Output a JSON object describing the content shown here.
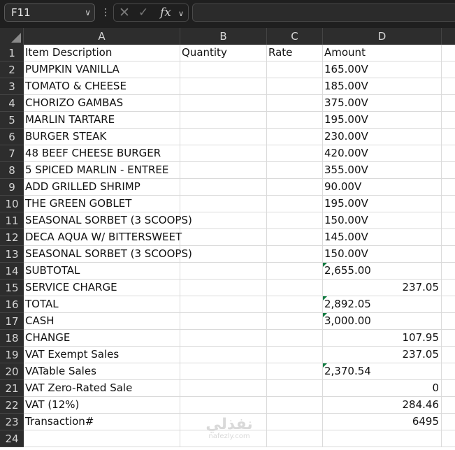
{
  "toolbar": {
    "name_box": "F11",
    "fx_label": "fx",
    "formula_value": ""
  },
  "columns": [
    "A",
    "B",
    "C",
    "D"
  ],
  "rows": [
    {
      "num": "1",
      "a": "Item Description",
      "b": "Quantity",
      "c": "Rate",
      "d_left": "Amount",
      "d_right": ""
    },
    {
      "num": "2",
      "a": "PUMPKIN VANILLA",
      "b": "",
      "c": "",
      "d_left": "165.00V",
      "d_right": ""
    },
    {
      "num": "3",
      "a": "TOMATO & CHEESE",
      "b": "",
      "c": "",
      "d_left": "185.00V",
      "d_right": ""
    },
    {
      "num": "4",
      "a": "CHORIZO GAMBAS",
      "b": "",
      "c": "",
      "d_left": "375.00V",
      "d_right": ""
    },
    {
      "num": "5",
      "a": "MARLIN TARTARE",
      "b": "",
      "c": "",
      "d_left": "195.00V",
      "d_right": ""
    },
    {
      "num": "6",
      "a": "BURGER STEAK",
      "b": "",
      "c": "",
      "d_left": "230.00V",
      "d_right": ""
    },
    {
      "num": "7",
      "a": "48 BEEF CHEESE BURGER",
      "b": "",
      "c": "",
      "d_left": "420.00V",
      "d_right": ""
    },
    {
      "num": "8",
      "a": "5 SPICED MARLIN - ENTREE",
      "b": "",
      "c": "",
      "d_left": "355.00V",
      "d_right": ""
    },
    {
      "num": "9",
      "a": "ADD GRILLED SHRIMP",
      "b": "",
      "c": "",
      "d_left": "90.00V",
      "d_right": ""
    },
    {
      "num": "10",
      "a": "THE GREEN GOBLET",
      "b": "",
      "c": "",
      "d_left": "195.00V",
      "d_right": ""
    },
    {
      "num": "11",
      "a": "SEASONAL SORBET (3 SCOOPS)",
      "b": "",
      "c": "",
      "d_left": "150.00V",
      "d_right": ""
    },
    {
      "num": "12",
      "a": "DECA AQUA W/ BITTERSWEET",
      "b": "",
      "c": "",
      "d_left": "145.00V",
      "d_right": ""
    },
    {
      "num": "13",
      "a": "SEASONAL SORBET (3 SCOOPS)",
      "b": "",
      "c": "",
      "d_left": "150.00V",
      "d_right": ""
    },
    {
      "num": "14",
      "a": "SUBTOTAL",
      "b": "",
      "c": "",
      "d_left": "2,655.00",
      "d_right": "",
      "flag": true
    },
    {
      "num": "15",
      "a": "SERVICE CHARGE",
      "b": "",
      "c": "",
      "d_left": "",
      "d_right": "237.05"
    },
    {
      "num": "16",
      "a": "TOTAL",
      "b": "",
      "c": "",
      "d_left": "2,892.05",
      "d_right": "",
      "flag": true
    },
    {
      "num": "17",
      "a": "CASH",
      "b": "",
      "c": "",
      "d_left": "3,000.00",
      "d_right": "",
      "flag": true
    },
    {
      "num": "18",
      "a": "CHANGE",
      "b": "",
      "c": "",
      "d_left": "",
      "d_right": "107.95"
    },
    {
      "num": "19",
      "a": "VAT Exempt Sales",
      "b": "",
      "c": "",
      "d_left": "",
      "d_right": "237.05"
    },
    {
      "num": "20",
      "a": "VATable Sales",
      "b": "",
      "c": "",
      "d_left": "2,370.54",
      "d_right": "",
      "flag": true
    },
    {
      "num": "21",
      "a": "VAT Zero-Rated Sale",
      "b": "",
      "c": "",
      "d_left": "",
      "d_right": "0"
    },
    {
      "num": "22",
      "a": "VAT (12%)",
      "b": "",
      "c": "",
      "d_left": "",
      "d_right": "284.46"
    },
    {
      "num": "23",
      "a": "Transaction#",
      "b": "",
      "c": "",
      "d_left": "",
      "d_right": "6495"
    },
    {
      "num": "24",
      "a": "",
      "b": "",
      "c": "",
      "d_left": "",
      "d_right": ""
    }
  ],
  "watermark": {
    "arabic": "نفذلي",
    "latin": "nafezly.com"
  },
  "colors": {
    "header_bg": "#2d2d2d",
    "error_flag": "#107c41",
    "toolbar_bg": "#1f1f1f"
  }
}
